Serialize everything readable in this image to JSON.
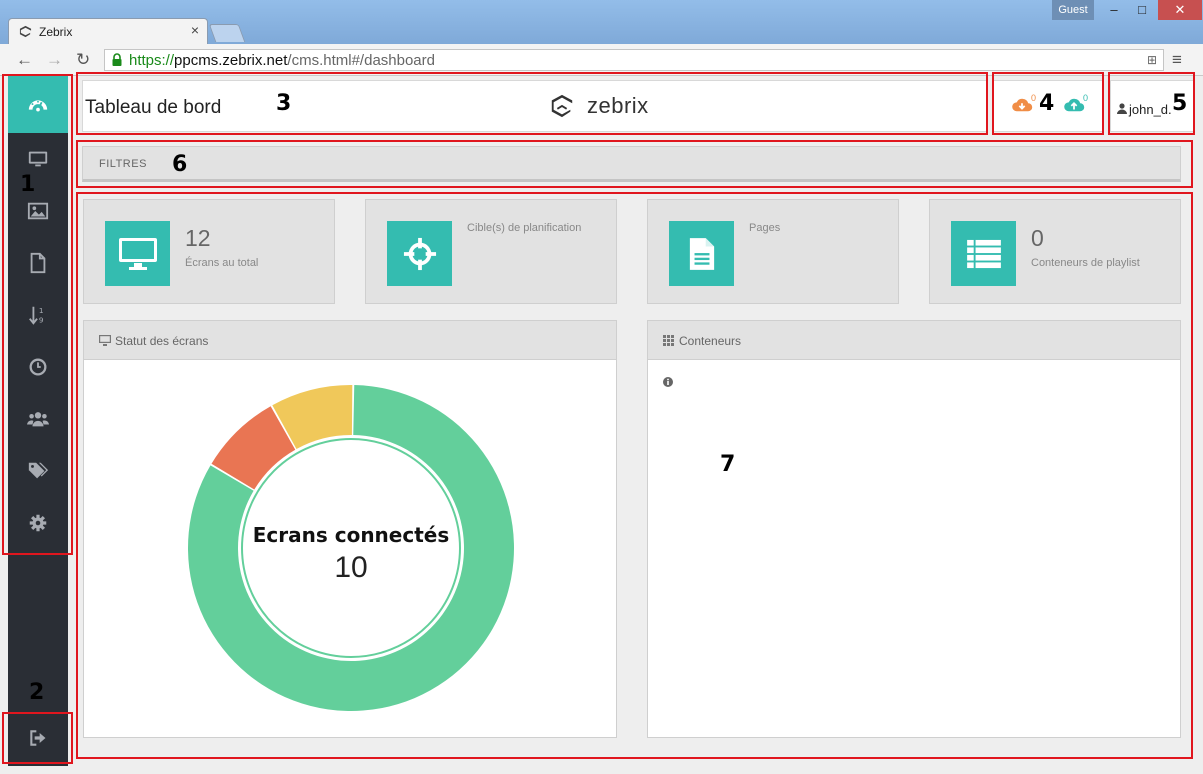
{
  "browser": {
    "tab_title": "Zebrix",
    "tab_close": "×",
    "guest_label": "Guest",
    "min": "–",
    "max": "□",
    "close": "✕",
    "url_scheme": "https://",
    "url_host": "ppcms.zebrix.net",
    "url_path": "/cms.html#/dashboard",
    "back": "←",
    "forward": "→",
    "reload": "↻",
    "menu": "≡",
    "translate": "⊞"
  },
  "header": {
    "title": "Tableau de bord",
    "brand": "zebrix",
    "sync_down_count": "0",
    "sync_up_count": "0",
    "username": "john_d."
  },
  "filters": {
    "label": "FILTRES"
  },
  "stats": [
    {
      "value": "12",
      "caption": "Écrans au total",
      "icon": "monitor-icon"
    },
    {
      "value": "",
      "caption": "Cible(s) de planification",
      "icon": "crosshair-icon"
    },
    {
      "value": "",
      "caption": "Pages",
      "icon": "document-icon"
    },
    {
      "value": "0",
      "caption": "Conteneurs de playlist",
      "icon": "list-icon"
    }
  ],
  "panels": {
    "screens_status": {
      "title": "Statut des écrans"
    },
    "containers": {
      "title": "Conteneurs"
    }
  },
  "chart_data": {
    "type": "pie",
    "title": "Ecrans connectés",
    "center_value": "10",
    "slices": [
      {
        "value": 10,
        "color": "#63cf9b"
      },
      {
        "value": 1,
        "color": "#e97553"
      },
      {
        "value": 1,
        "color": "#f0c85a"
      }
    ]
  },
  "sidebar": {
    "items": [
      "dashboard-icon",
      "monitor-icon",
      "image-icon",
      "page-icon",
      "sort-numeric-icon",
      "clock-icon",
      "users-icon",
      "tags-icon",
      "gear-icon"
    ],
    "logout": "logout-icon"
  },
  "annotations": [
    "1",
    "2",
    "3",
    "4",
    "5",
    "6",
    "7"
  ],
  "colors": {
    "accent": "#34bcb0",
    "sidebar": "#2a2e35",
    "sync_down": "#f08d46",
    "sync_up": "#34bcb0",
    "annotation": "#e0161e"
  }
}
